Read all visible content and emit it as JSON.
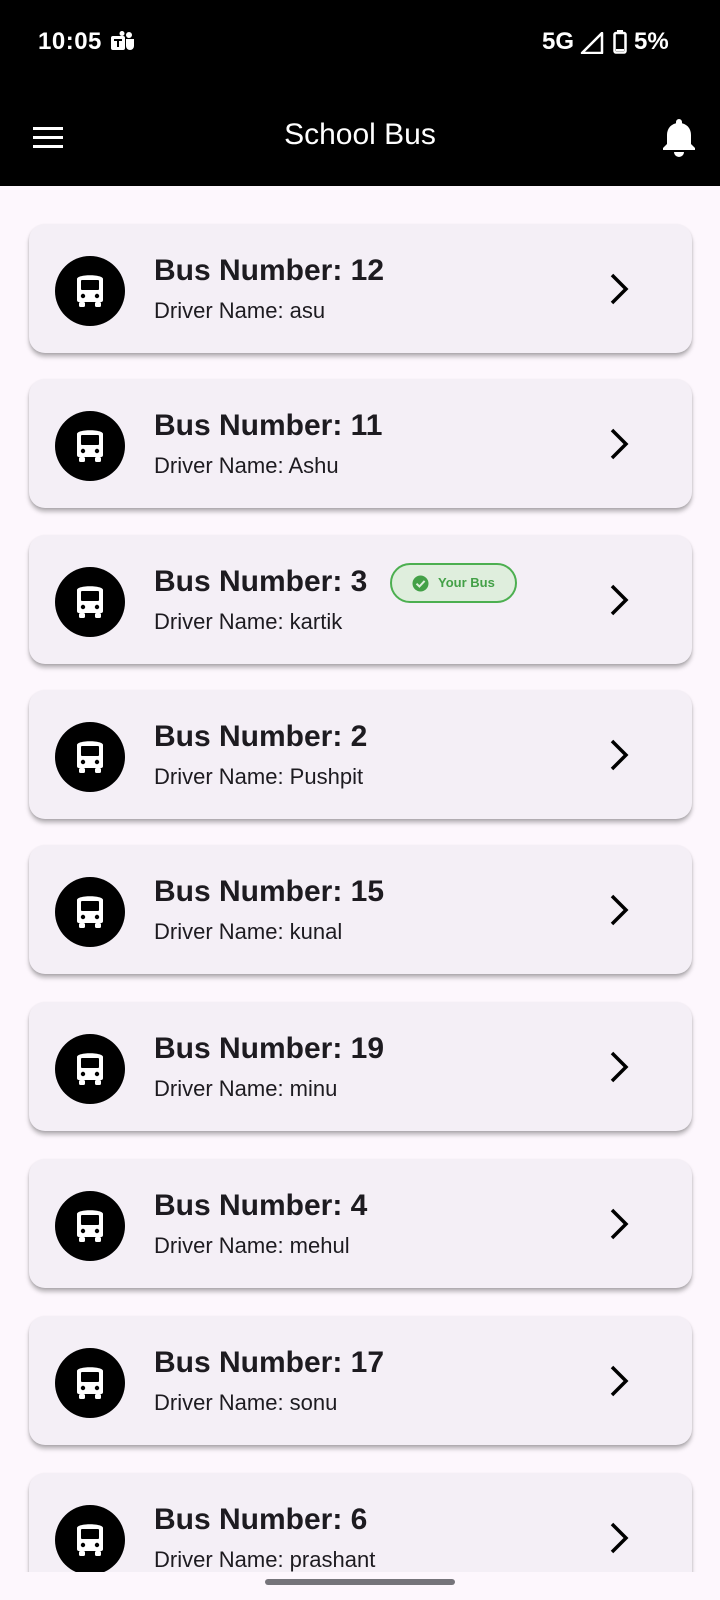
{
  "status_bar": {
    "time": "10:05",
    "network": "5G",
    "battery": "5%"
  },
  "app_bar": {
    "title": "School Bus"
  },
  "buses": [
    {
      "title": "Bus Number: 12",
      "driver": "Driver Name: asu",
      "your_bus": false
    },
    {
      "title": "Bus Number: 11",
      "driver": "Driver Name: Ashu",
      "your_bus": false
    },
    {
      "title": "Bus Number: 3",
      "driver": "Driver Name: kartik",
      "your_bus": true
    },
    {
      "title": "Bus Number: 2",
      "driver": "Driver Name: Pushpit",
      "your_bus": false
    },
    {
      "title": "Bus Number: 15",
      "driver": "Driver Name: kunal",
      "your_bus": false
    },
    {
      "title": "Bus Number: 19",
      "driver": "Driver Name: minu",
      "your_bus": false
    },
    {
      "title": "Bus Number: 4",
      "driver": "Driver Name: mehul",
      "your_bus": false
    },
    {
      "title": "Bus Number: 17",
      "driver": "Driver Name: sonu",
      "your_bus": false
    },
    {
      "title": "Bus Number: 6",
      "driver": "Driver Name: prashant",
      "your_bus": false
    }
  ],
  "badge": {
    "label": "Your Bus",
    "icon": "check-circle-icon",
    "color": "#4caf50"
  },
  "icons": {
    "menu": "menu-icon",
    "notification": "bell-icon",
    "bus": "bus-icon",
    "row_action": "chevron-right-icon"
  },
  "colors": {
    "app_bar": "#000000",
    "background": "#fdf7fd",
    "card": "#f4eff6",
    "text": "#1d1b20"
  }
}
